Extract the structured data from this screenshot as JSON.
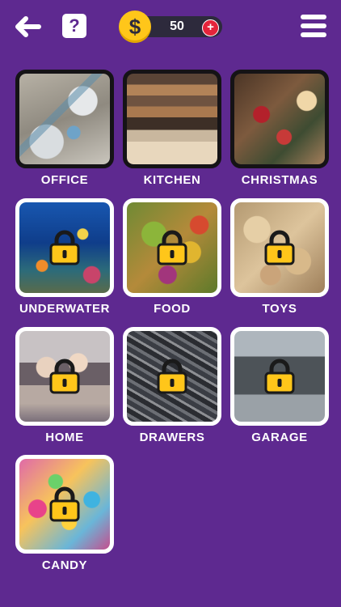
{
  "header": {
    "back_icon": "arrow-left-icon",
    "help_label": "?",
    "coin_symbol": "$",
    "coins": "50",
    "add_label": "+",
    "menu_icon": "hamburger-menu-icon"
  },
  "colors": {
    "background": "#5e2990",
    "coin": "#ffc61a",
    "add_button": "#e5243b",
    "lock": "#ffc61a"
  },
  "levels": [
    {
      "label": "OFFICE",
      "locked": false
    },
    {
      "label": "KITCHEN",
      "locked": false
    },
    {
      "label": "CHRISTMAS",
      "locked": false
    },
    {
      "label": "UNDERWATER",
      "locked": true
    },
    {
      "label": "FOOD",
      "locked": true
    },
    {
      "label": "TOYS",
      "locked": true
    },
    {
      "label": "HOME",
      "locked": true
    },
    {
      "label": "DRAWERS",
      "locked": true
    },
    {
      "label": "GARAGE",
      "locked": true
    },
    {
      "label": "CANDY",
      "locked": true
    }
  ]
}
